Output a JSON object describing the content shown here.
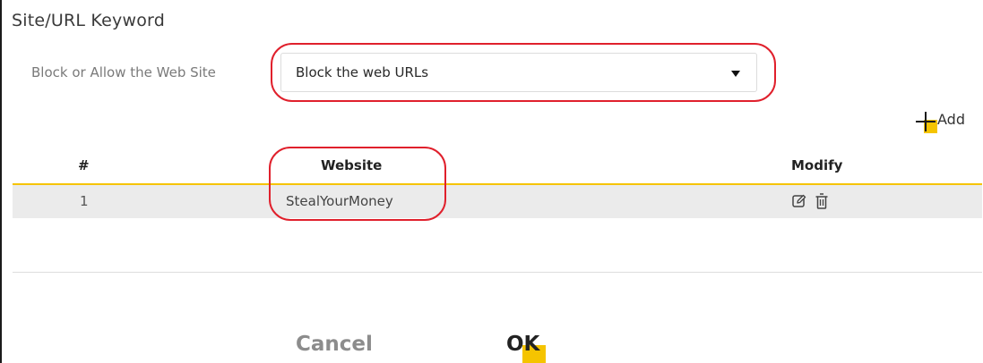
{
  "section": {
    "title": "Site/URL Keyword"
  },
  "filter": {
    "label": "Block or Allow the Web Site",
    "selected": "Block the web URLs"
  },
  "toolbar": {
    "add_label": "Add",
    "add_icon": "plus-icon"
  },
  "table": {
    "columns": [
      "#",
      "Website",
      "Modify"
    ],
    "rows": [
      {
        "index": "1",
        "website": "StealYourMoney",
        "actions": [
          "edit-icon",
          "trash-icon"
        ]
      }
    ]
  },
  "footer": {
    "cancel_label": "Cancel",
    "ok_label": "OK"
  },
  "colors": {
    "accent": "#f5c400",
    "highlight_outline": "#e0202c",
    "row_bg": "#ebebeb"
  }
}
